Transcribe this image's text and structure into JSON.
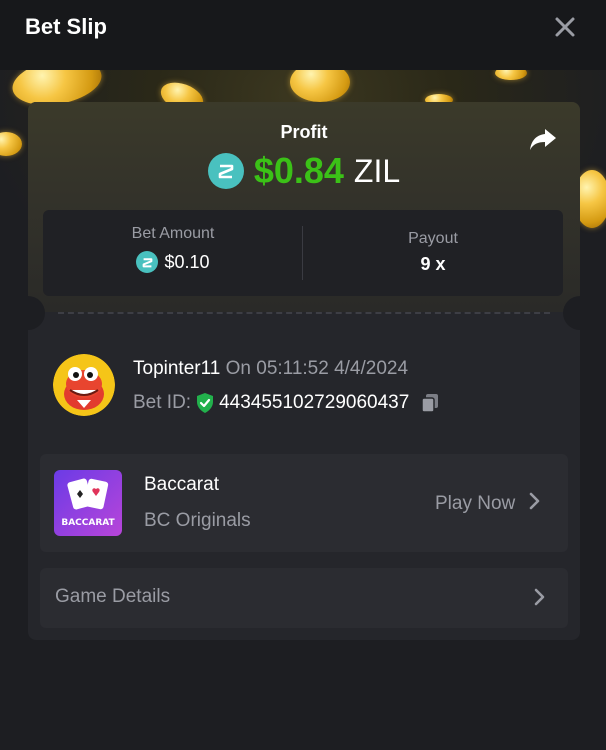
{
  "header": {
    "title": "Bet Slip",
    "close_icon": "close-icon"
  },
  "profit": {
    "label": "Profit",
    "amount": "$0.84",
    "currency": "ZIL",
    "amount_color": "#3bc117",
    "coin_color": "#49c1bf",
    "share_icon": "share-icon"
  },
  "stats": {
    "bet_amount_label": "Bet Amount",
    "bet_amount_value": "$0.10",
    "payout_label": "Payout",
    "payout_value": "9 x"
  },
  "user": {
    "name": "Topinter11",
    "on_label": "On",
    "datetime": "05:11:52 4/4/2024",
    "bet_id_label": "Bet ID:",
    "bet_id": "443455102729060437",
    "verified_icon": "shield-check-icon",
    "copy_icon": "copy-icon"
  },
  "game": {
    "title": "Baccarat",
    "provider": "BC Originals",
    "thumb_text": "BACCARAT",
    "play_label": "Play Now"
  },
  "details": {
    "label": "Game Details"
  }
}
